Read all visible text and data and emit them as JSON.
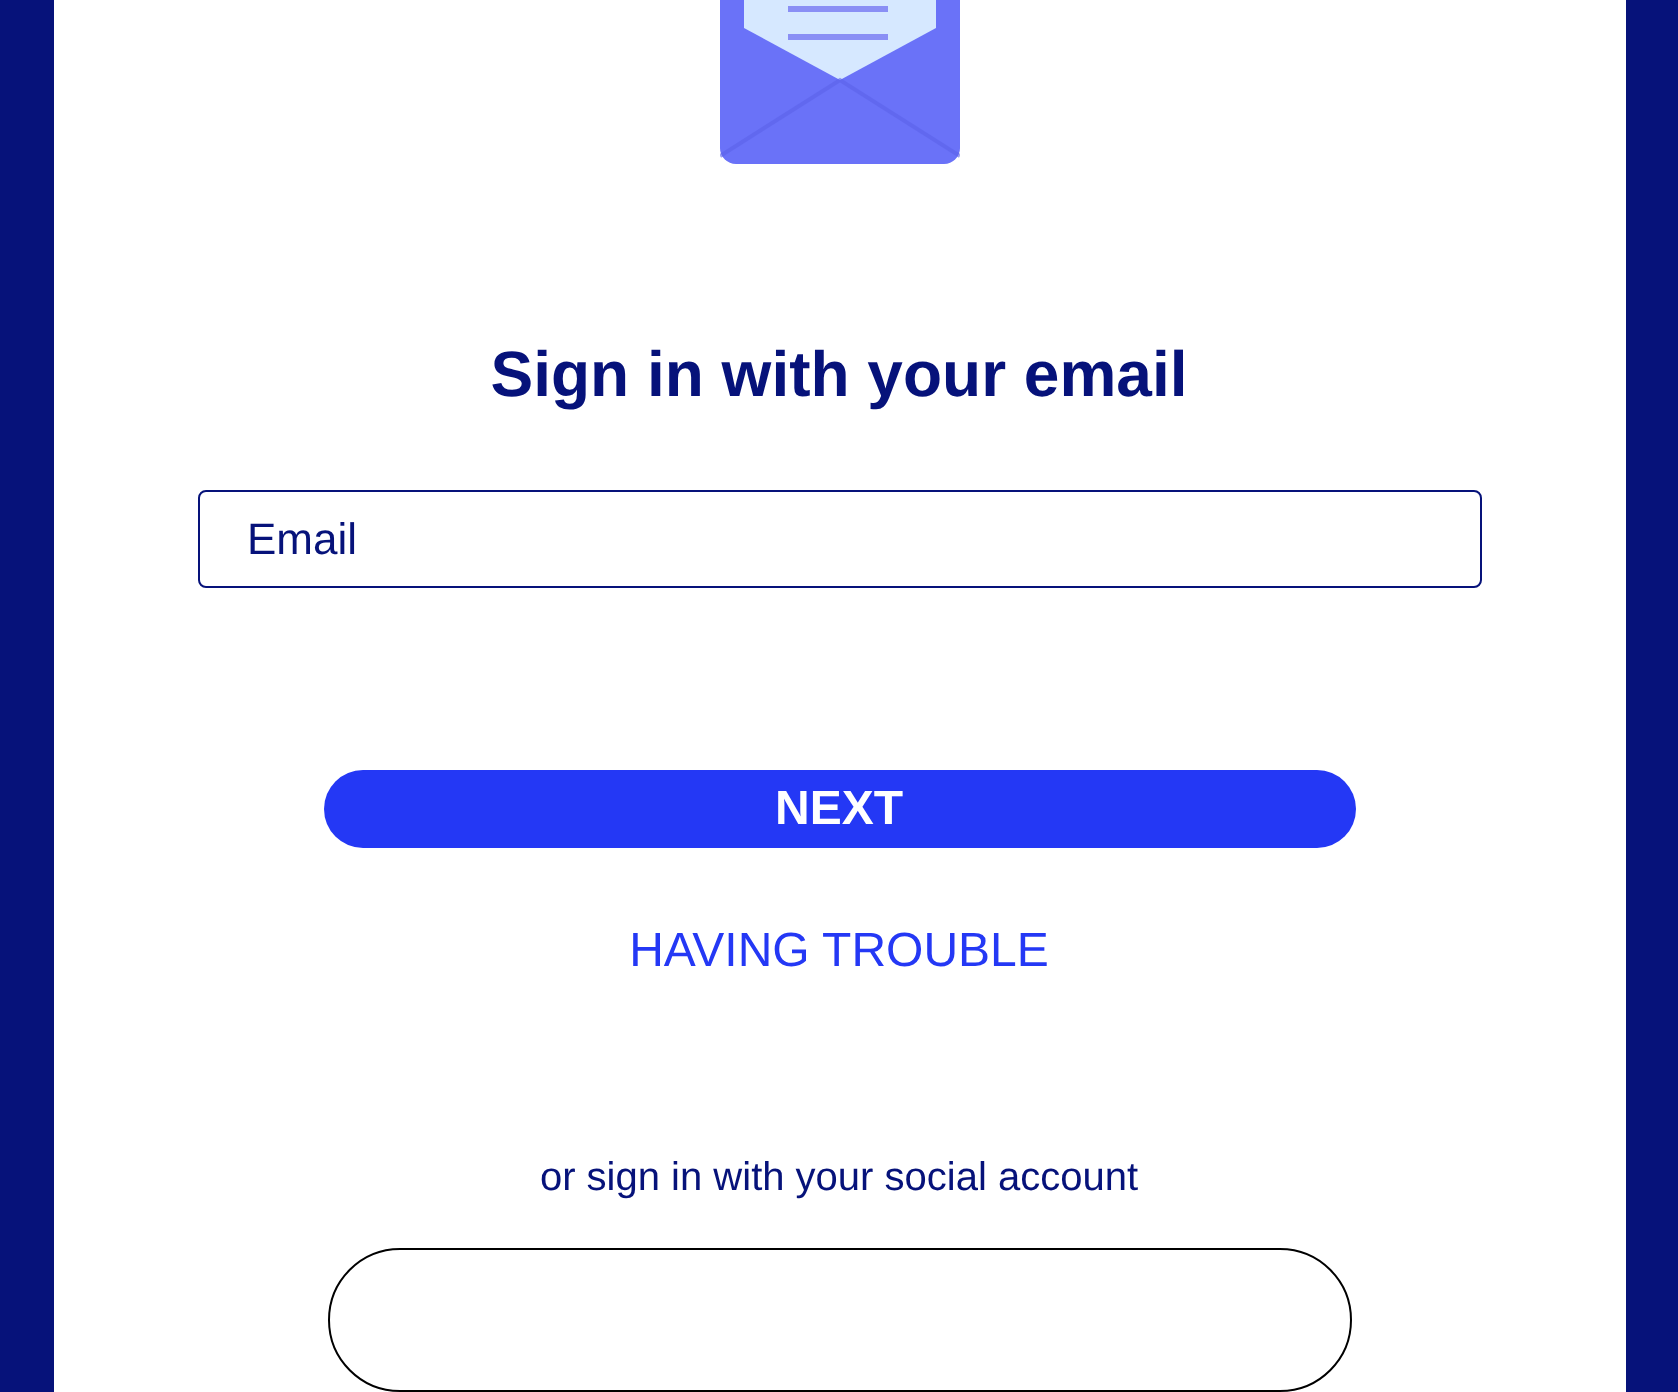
{
  "title": "Sign in with your email",
  "email_field": {
    "placeholder": "Email"
  },
  "next_button": "NEXT",
  "help_link": "HAVING TROUBLE",
  "social_prompt": "or sign in with your social account"
}
